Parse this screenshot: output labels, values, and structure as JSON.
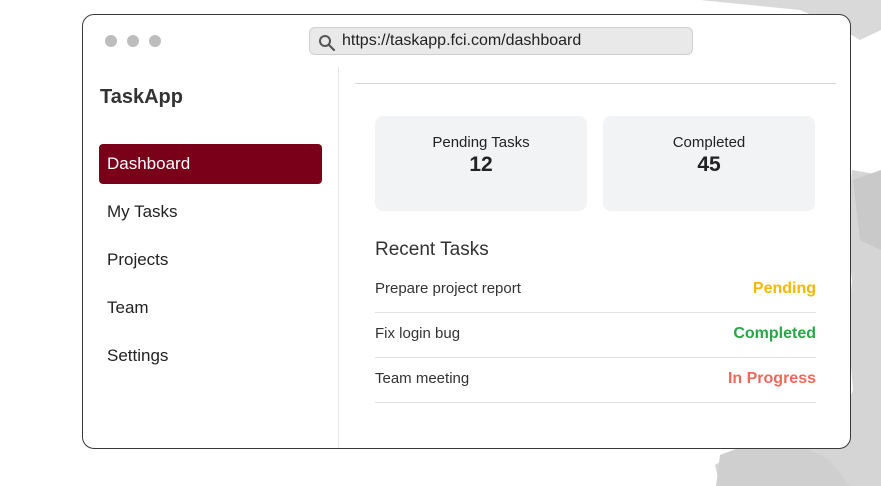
{
  "browser": {
    "url": "https://taskapp.fci.com/dashboard",
    "search_icon": "search-icon"
  },
  "sidebar": {
    "brand": "TaskApp",
    "items": [
      {
        "label": "Dashboard",
        "active": true
      },
      {
        "label": "My Tasks",
        "active": false
      },
      {
        "label": "Projects",
        "active": false
      },
      {
        "label": "Team",
        "active": false
      },
      {
        "label": "Settings",
        "active": false
      }
    ],
    "active_color": "#7a0019"
  },
  "stats": [
    {
      "label": "Pending Tasks",
      "value": "12"
    },
    {
      "label": "Completed",
      "value": "45"
    }
  ],
  "recent": {
    "title": "Recent Tasks",
    "tasks": [
      {
        "name": "Prepare project report",
        "status": "Pending",
        "color": "#f5b800"
      },
      {
        "name": "Fix login bug",
        "status": "Completed",
        "color": "#27a745"
      },
      {
        "name": "Team meeting",
        "status": "In Progress",
        "color": "#f0675c"
      }
    ]
  }
}
